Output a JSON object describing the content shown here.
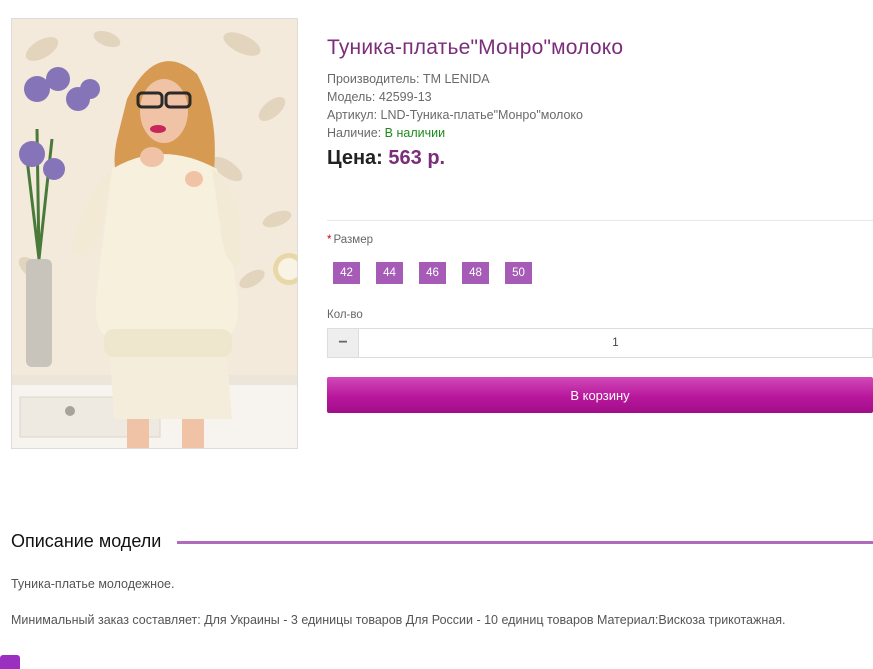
{
  "product": {
    "title": "Туника-платье\"Монро\"молоко",
    "manufacturer": "Производитель: ТМ LENIDA",
    "model": "Модель: 42599-13",
    "sku": "Артикул: LND-Туника-платье\"Монро\"молоко",
    "availability_label": "Наличие: ",
    "availability_value": "В наличии",
    "price_label": "Цена:",
    "price_value": "563 р.",
    "image_alt": "product-photo-woman-in-milk-tunic-dress"
  },
  "options": {
    "size_required_mark": "*",
    "size_label": "Размер",
    "sizes": [
      "42",
      "44",
      "46",
      "48",
      "50"
    ],
    "qty_label": "Кол-во",
    "qty_minus": "−",
    "qty_value": "1"
  },
  "cart": {
    "button_label": "В корзину"
  },
  "description": {
    "title": "Описание модели",
    "paragraph_1": "Туника-платье молодежное.",
    "paragraph_2": "Минимальный заказ составляет: Для Украины - 3 единицы товаров Для России - 10 единиц товаров Материал:Вискоза трикотажная."
  },
  "colors": {
    "accent": "#a65cb6",
    "title": "#7a2e7a",
    "cart": "#b8179c",
    "in_stock": "#1e8a1e"
  }
}
